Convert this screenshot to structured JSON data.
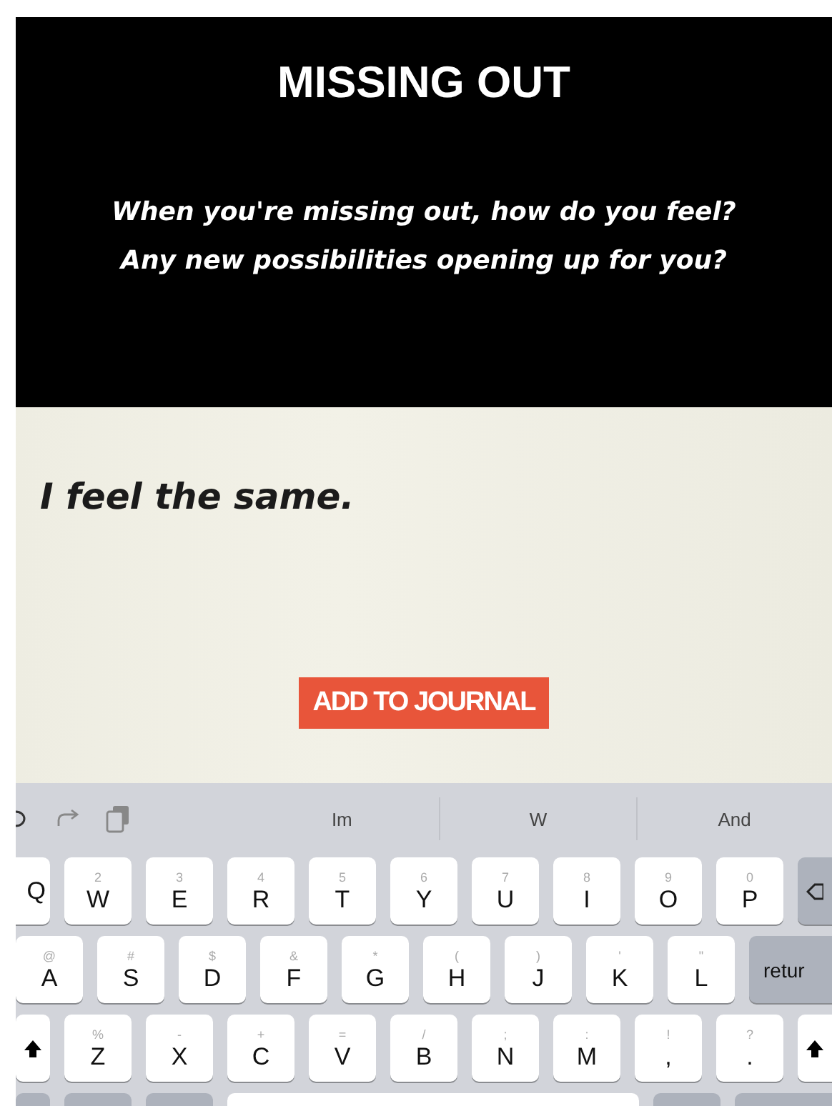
{
  "header": {
    "title": "MISSING OUT",
    "prompt_lines": [
      "When you're missing out, how do you feel?",
      "Any new possibilities opening up for you?"
    ]
  },
  "entry": {
    "value": "I feel the same."
  },
  "add_button": {
    "label": "ADD TO JOURNAL"
  },
  "keyboard": {
    "suggestions": [
      "Im",
      "W",
      "And"
    ],
    "rows": [
      [
        {
          "kind": "edge",
          "label": "Q"
        },
        {
          "kind": "letter",
          "label": "W",
          "hint": "2"
        },
        {
          "kind": "letter",
          "label": "E",
          "hint": "3"
        },
        {
          "kind": "letter",
          "label": "R",
          "hint": "4"
        },
        {
          "kind": "letter",
          "label": "T",
          "hint": "5"
        },
        {
          "kind": "letter",
          "label": "Y",
          "hint": "6"
        },
        {
          "kind": "letter",
          "label": "U",
          "hint": "7"
        },
        {
          "kind": "letter",
          "label": "I",
          "hint": "8"
        },
        {
          "kind": "letter",
          "label": "O",
          "hint": "9"
        },
        {
          "kind": "letter",
          "label": "P",
          "hint": "0"
        },
        {
          "kind": "delete"
        }
      ],
      [
        {
          "kind": "letter",
          "label": "A",
          "hint": "@"
        },
        {
          "kind": "letter",
          "label": "S",
          "hint": "#"
        },
        {
          "kind": "letter",
          "label": "D",
          "hint": "$"
        },
        {
          "kind": "letter",
          "label": "F",
          "hint": "&"
        },
        {
          "kind": "letter",
          "label": "G",
          "hint": "*"
        },
        {
          "kind": "letter",
          "label": "H",
          "hint": "("
        },
        {
          "kind": "letter",
          "label": "J",
          "hint": ")"
        },
        {
          "kind": "letter",
          "label": "K",
          "hint": "'"
        },
        {
          "kind": "letter",
          "label": "L",
          "hint": "\""
        },
        {
          "kind": "return",
          "label": "retur"
        }
      ],
      [
        {
          "kind": "shift"
        },
        {
          "kind": "letter",
          "label": "Z",
          "hint": "%"
        },
        {
          "kind": "letter",
          "label": "X",
          "hint": "-"
        },
        {
          "kind": "letter",
          "label": "C",
          "hint": "+"
        },
        {
          "kind": "letter",
          "label": "V",
          "hint": "="
        },
        {
          "kind": "letter",
          "label": "B",
          "hint": "/"
        },
        {
          "kind": "letter",
          "label": "N",
          "hint": ";"
        },
        {
          "kind": "letter",
          "label": "M",
          "hint": ":"
        },
        {
          "kind": "letter",
          "label": ",",
          "hint": "!"
        },
        {
          "kind": "letter",
          "label": ".",
          "hint": "?"
        },
        {
          "kind": "shift"
        }
      ],
      [
        {
          "kind": "blank"
        },
        {
          "kind": "blank"
        },
        {
          "kind": "blank"
        },
        {
          "kind": "space"
        },
        {
          "kind": "blank"
        },
        {
          "kind": "blank"
        }
      ]
    ]
  }
}
